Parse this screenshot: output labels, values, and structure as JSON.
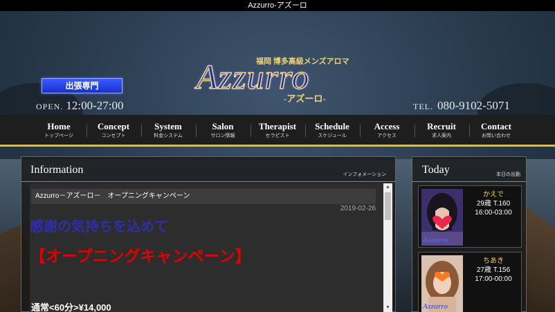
{
  "topbar": {
    "title": "Azzurro-アズーロ"
  },
  "header": {
    "badge": "出張専門",
    "open_label": "OPEN.",
    "open_hours": "12:00-27:00",
    "tel_label": "TEL.",
    "tel_number": "080-9102-5071",
    "logo_sub": "福岡 博多高級メンズアロマ",
    "logo_main": "Azzurro",
    "logo_kana": "-アズーロ-"
  },
  "nav": [
    {
      "en": "Home",
      "jp": "トップページ"
    },
    {
      "en": "Concept",
      "jp": "コンセプト"
    },
    {
      "en": "System",
      "jp": "料金システム"
    },
    {
      "en": "Salon",
      "jp": "サロン情報"
    },
    {
      "en": "Therapist",
      "jp": "セラピスト"
    },
    {
      "en": "Schedule",
      "jp": "スケジュール"
    },
    {
      "en": "Access",
      "jp": "アクセス"
    },
    {
      "en": "Recruit",
      "jp": "求人案内"
    },
    {
      "en": "Contact",
      "jp": "お問い合わせ"
    }
  ],
  "information": {
    "title": "Information",
    "subtitle": "インフォメーション",
    "post_title": "Azzurro－アズーロ－　オープニングキャンペーン",
    "post_date": "2019-02-26",
    "line1": "感謝の気持ちを込めて",
    "line2": "【オープニングキャンペーン】",
    "line3": "通常<60分>¥14,000"
  },
  "today": {
    "title": "Today",
    "subtitle": "本日の出勤",
    "watermark": "Azzurro",
    "therapists": [
      {
        "name": "かえで",
        "profile": "29歳 T.160",
        "time": "16:00-03:00"
      },
      {
        "name": "ちあき",
        "profile": "27歳 T.156",
        "time": "17:00-00:00"
      }
    ]
  },
  "colors": {
    "accent_gold": "#e6c400",
    "badge_blue": "#1a2fd0",
    "campaign_red": "#e00000",
    "heading_blue": "#2e2ea8"
  }
}
